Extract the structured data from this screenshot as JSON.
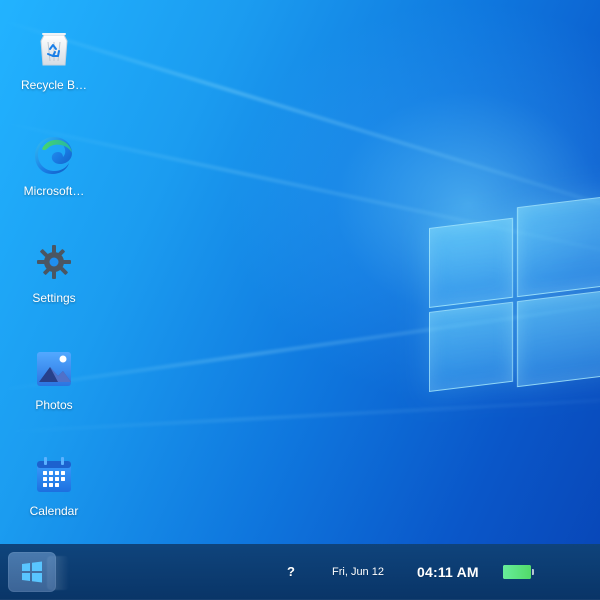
{
  "desktop": {
    "icons": [
      {
        "label": "Recycle B…",
        "icon": "recycle-bin-icon"
      },
      {
        "label": "Microsoft…",
        "icon": "edge-icon"
      },
      {
        "label": "Settings",
        "icon": "gear-icon"
      },
      {
        "label": "Photos",
        "icon": "photos-icon"
      },
      {
        "label": "Calendar",
        "icon": "calendar-icon"
      }
    ],
    "wallpaper": {
      "style": "windows-10-blue",
      "accent": "#1b9cf0"
    }
  },
  "taskbar": {
    "start_icon": "windows-logo-icon",
    "help_label": "?",
    "date": "Fri, Jun 12",
    "time": "04:11 AM",
    "battery_level": 1.0,
    "colors": {
      "background": "#0f437a",
      "battery": "#5beb85"
    }
  }
}
